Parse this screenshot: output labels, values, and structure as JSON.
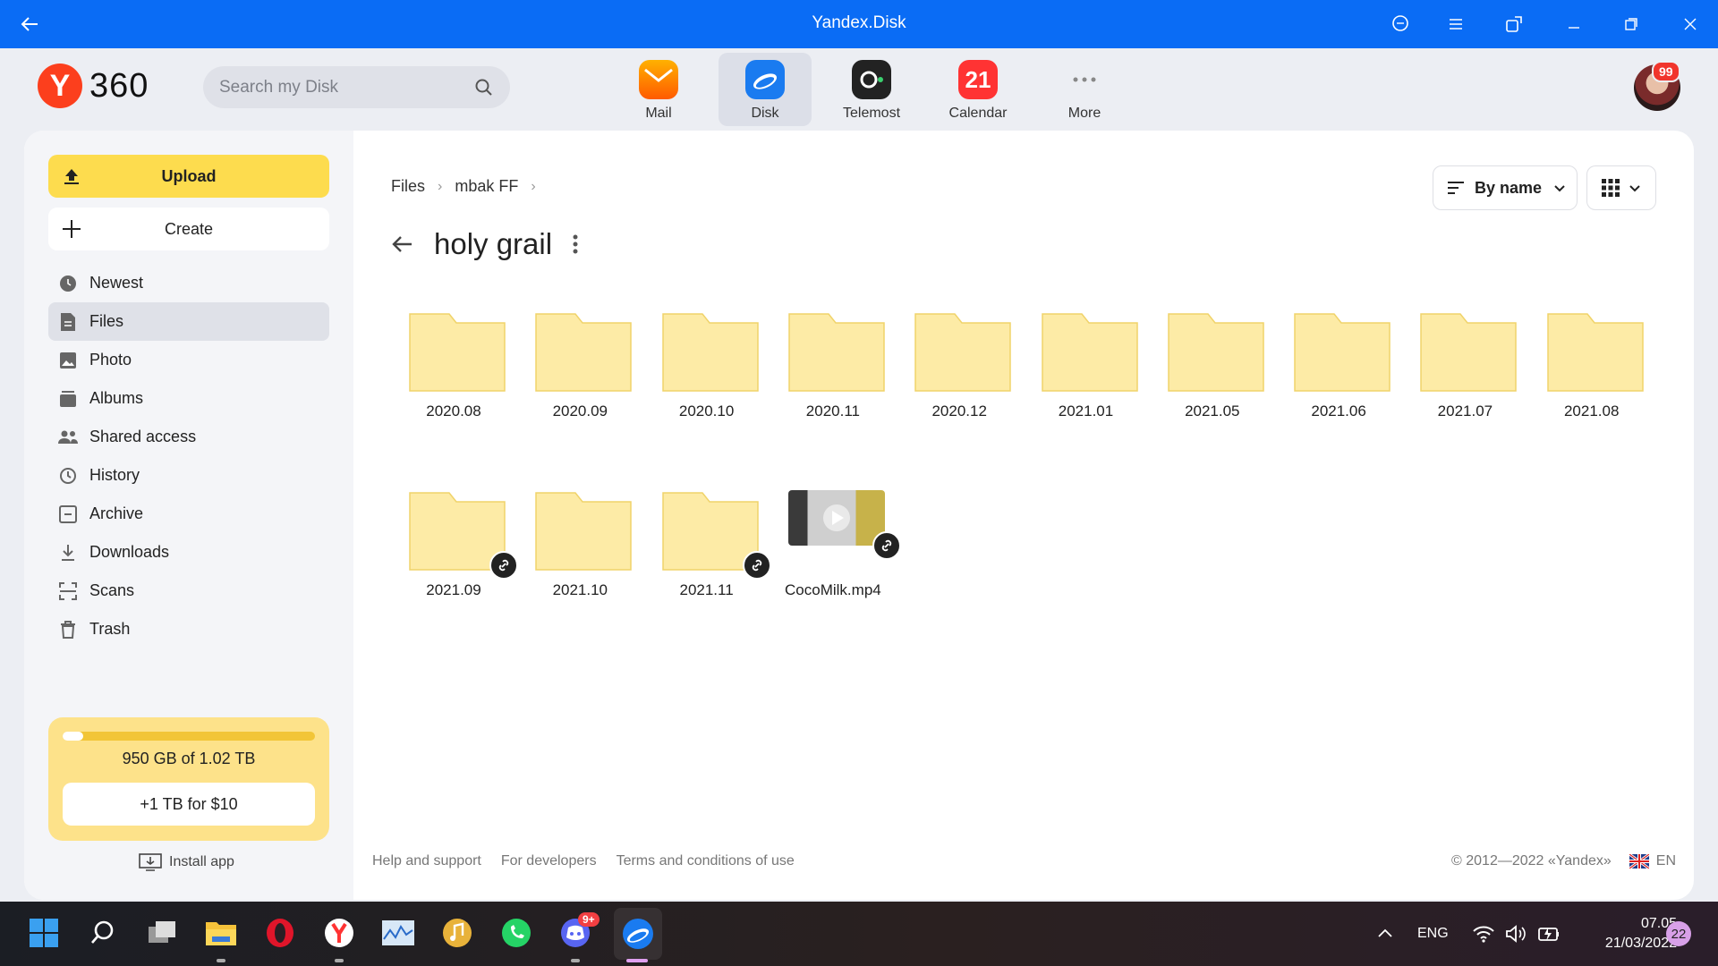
{
  "window": {
    "title": "Yandex.Disk"
  },
  "header": {
    "logo_letter": "Y",
    "logo_text": "360",
    "search_placeholder": "Search my Disk",
    "apps": [
      {
        "label": "Mail"
      },
      {
        "label": "Disk"
      },
      {
        "label": "Telemost"
      },
      {
        "label": "Calendar",
        "day": "21"
      },
      {
        "label": "More"
      }
    ],
    "avatar_badge": "99"
  },
  "sidebar": {
    "upload_label": "Upload",
    "create_label": "Create",
    "items": [
      {
        "label": "Newest"
      },
      {
        "label": "Files"
      },
      {
        "label": "Photo"
      },
      {
        "label": "Albums"
      },
      {
        "label": "Shared access"
      },
      {
        "label": "History"
      },
      {
        "label": "Archive"
      },
      {
        "label": "Downloads"
      },
      {
        "label": "Scans"
      },
      {
        "label": "Trash"
      }
    ],
    "storage_text": "950 GB of 1.02 TB",
    "storage_used_fraction": 0.08,
    "buy_label": "+1 TB for $10",
    "install_label": "Install app"
  },
  "main": {
    "breadcrumb": [
      "Files",
      "mbak FF"
    ],
    "sort_label": "By name",
    "folder_title": "holy grail",
    "items": [
      {
        "name": "2020.08",
        "type": "folder",
        "shared": false
      },
      {
        "name": "2020.09",
        "type": "folder",
        "shared": false
      },
      {
        "name": "2020.10",
        "type": "folder",
        "shared": false
      },
      {
        "name": "2020.11",
        "type": "folder",
        "shared": false
      },
      {
        "name": "2020.12",
        "type": "folder",
        "shared": false
      },
      {
        "name": "2021.01",
        "type": "folder",
        "shared": false
      },
      {
        "name": "2021.05",
        "type": "folder",
        "shared": false
      },
      {
        "name": "2021.06",
        "type": "folder",
        "shared": false
      },
      {
        "name": "2021.07",
        "type": "folder",
        "shared": false
      },
      {
        "name": "2021.08",
        "type": "folder",
        "shared": false
      },
      {
        "name": "2021.09",
        "type": "folder",
        "shared": true
      },
      {
        "name": "2021.10",
        "type": "folder",
        "shared": false
      },
      {
        "name": "2021.11",
        "type": "folder",
        "shared": true
      },
      {
        "name": "CocoMilk.mp4",
        "type": "video",
        "shared": true
      }
    ]
  },
  "footer": {
    "links": [
      "Help and support",
      "For developers",
      "Terms and conditions of use"
    ],
    "copyright": "© 2012—2022 «Yandex»",
    "lang": "EN"
  },
  "taskbar": {
    "discord_badge": "9+",
    "lang": "ENG",
    "time": "07.05",
    "date": "21/03/2022",
    "notif_count": "22"
  },
  "colors": {
    "titlebar": "#0a6cf5",
    "upload": "#fddc4e",
    "folder": "#fdeba6",
    "storage": "#fde28a"
  }
}
